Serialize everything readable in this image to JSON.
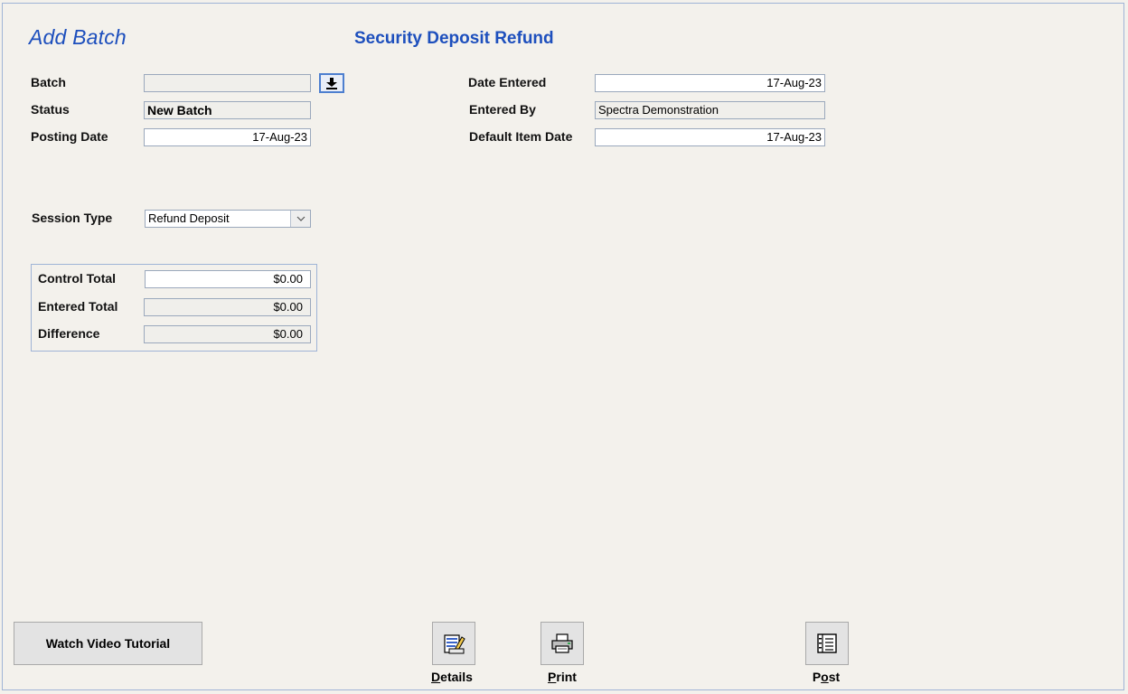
{
  "header": {
    "form_title": "Add Batch",
    "screen_title": "Security Deposit Refund"
  },
  "batch": {
    "label": "Batch",
    "value": "",
    "dropdown_icon": "download-arrow-icon"
  },
  "status": {
    "label": "Status",
    "value": "New Batch"
  },
  "posting_date": {
    "label": "Posting Date",
    "value": "17-Aug-23"
  },
  "date_entered": {
    "label": "Date Entered",
    "value": "17-Aug-23"
  },
  "entered_by": {
    "label": "Entered By",
    "value": "Spectra Demonstration"
  },
  "default_item_date": {
    "label": "Default Item Date",
    "value": "17-Aug-23"
  },
  "session_type": {
    "label": "Session Type",
    "value": "Refund Deposit"
  },
  "totals": {
    "control_total": {
      "label": "Control Total",
      "value": "$0.00"
    },
    "entered_total": {
      "label": "Entered Total",
      "value": "$0.00"
    },
    "difference": {
      "label": "Difference",
      "value": "$0.00"
    }
  },
  "footer": {
    "video_button": "Watch Video Tutorial",
    "details": {
      "first": "D",
      "rest": "etails",
      "icon": "edit-document-icon"
    },
    "print": {
      "first": "P",
      "rest": "rint",
      "icon": "printer-icon"
    },
    "post": {
      "pre": "P",
      "ul": "o",
      "rest": "st",
      "icon": "ledger-book-icon"
    }
  },
  "colors": {
    "title_blue": "#1d4fbd",
    "background": "#f3f1ec",
    "border_blue": "#9fb4d6"
  }
}
